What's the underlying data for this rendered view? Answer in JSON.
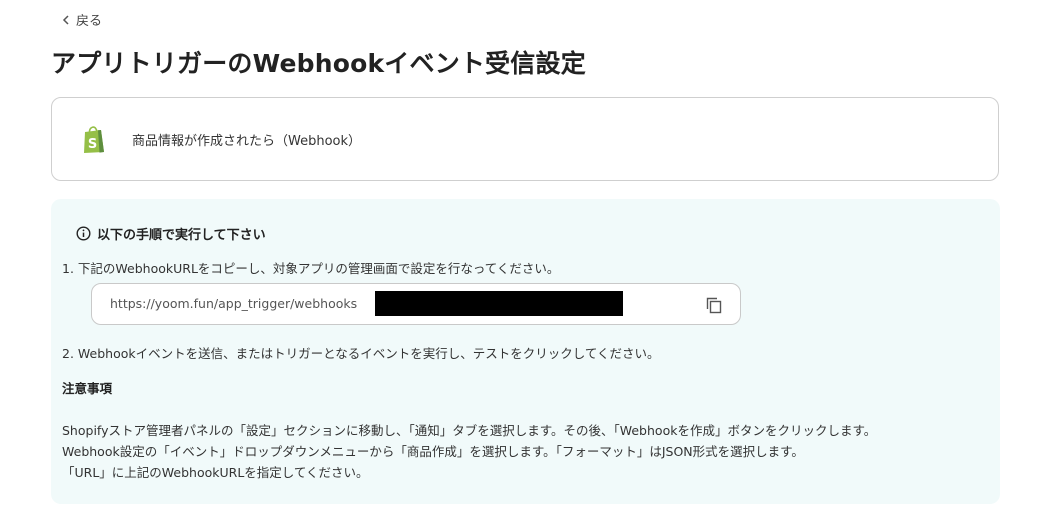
{
  "back": {
    "label": "戻る"
  },
  "page": {
    "title": "アプリトリガーのWebhookイベント受信設定"
  },
  "trigger": {
    "label": "商品情報が作成されたら（Webhook）"
  },
  "instructions": {
    "heading": "以下の手順で実行して下さい",
    "step1": "1. 下記のWebhookURLをコピーし、対象アプリの管理画面で設定を行なってください。",
    "url": "https://yoom.fun/app_trigger/webhooks",
    "step2": "2. Webhookイベントを送信、またはトリガーとなるイベントを実行し、テストをクリックしてください。",
    "caution_heading": "注意事項",
    "notes": [
      "Shopifyストア管理者パネルの「設定」セクションに移動し、「通知」タブを選択します。その後、「Webhookを作成」ボタンをクリックします。",
      "Webhook設定の「イベント」ドロップダウンメニューから「商品作成」を選択します。「フォーマット」はJSON形式を選択します。",
      "「URL」に上記のWebhookURLを指定してください。"
    ]
  },
  "colors": {
    "instructions_bg": "#f1fafa",
    "shopify_green": "#95bf47",
    "shopify_dark": "#5e8e3e"
  }
}
